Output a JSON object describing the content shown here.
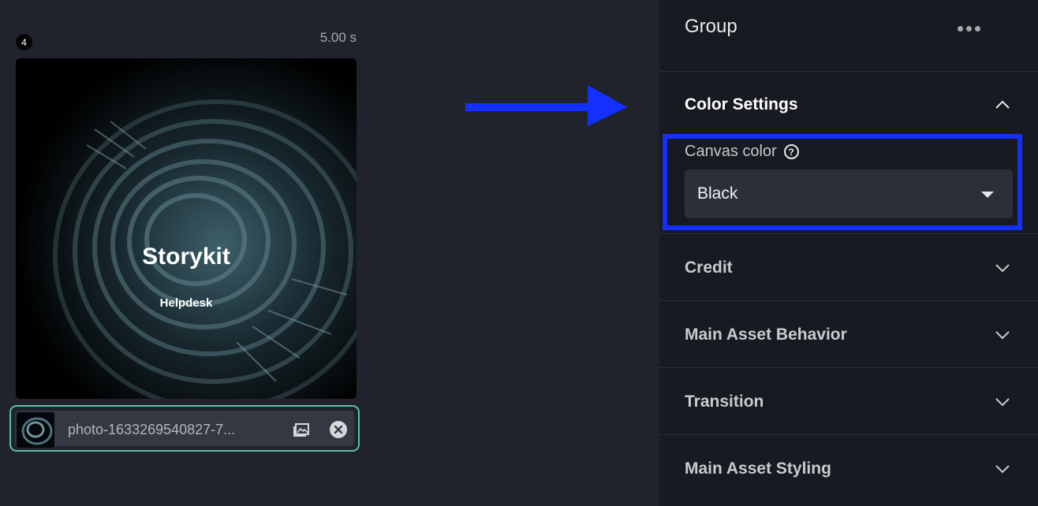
{
  "scene": {
    "index": "4",
    "duration": "5.00 s",
    "preview": {
      "title": "Storykit",
      "subtitle": "Helpdesk"
    },
    "asset": {
      "filename": "photo-1633269540827-7..."
    }
  },
  "panel": {
    "title": "Group",
    "sections": [
      {
        "label": "Color Settings",
        "expanded": true
      },
      {
        "label": "Credit",
        "expanded": false
      },
      {
        "label": "Main Asset Behavior",
        "expanded": false
      },
      {
        "label": "Transition",
        "expanded": false
      },
      {
        "label": "Main Asset Styling",
        "expanded": false
      }
    ],
    "color_settings": {
      "canvas_color_label": "Canvas color",
      "canvas_color_value": "Black"
    }
  },
  "colors": {
    "annotation_blue": "#1430ff",
    "asset_border": "#5bbfa6",
    "panel_bg": "#181a21",
    "page_bg": "#20232b"
  },
  "icons": [
    "more-icon",
    "chevron-up-icon",
    "chevron-down-icon",
    "help-icon",
    "image-icon",
    "close-icon",
    "caret-down-icon",
    "arrow-right-icon"
  ]
}
